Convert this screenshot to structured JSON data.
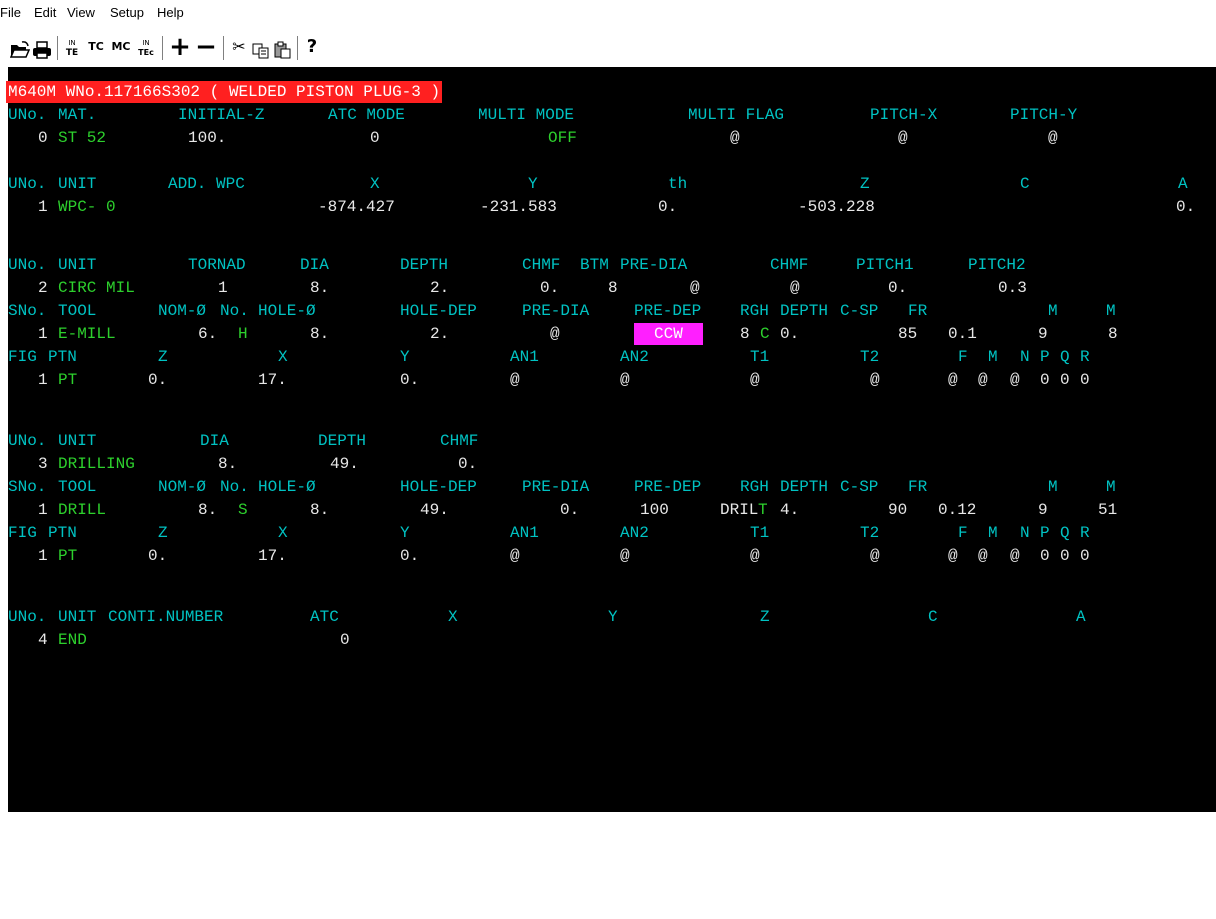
{
  "menu": [
    "File",
    "Edit",
    "View",
    "Setup",
    "Help"
  ],
  "toolbar": {
    "icons": [
      {
        "name": "open-icon",
        "glyph": "📂"
      },
      {
        "name": "print-icon",
        "glyph": "🖶"
      },
      {
        "name": "tool-te-icon",
        "glyph": "IN\nTE"
      },
      {
        "name": "tc-icon",
        "glyph": "TC"
      },
      {
        "name": "mc-icon",
        "glyph": "MC"
      },
      {
        "name": "tool-tec-icon",
        "glyph": "IN\nTEc"
      },
      {
        "name": "plus-icon",
        "glyph": "+"
      },
      {
        "name": "minus-icon",
        "glyph": "—"
      },
      {
        "name": "cut-icon",
        "glyph": "✂"
      },
      {
        "name": "copy-icon",
        "glyph": "⧉"
      },
      {
        "name": "paste-icon",
        "glyph": "📋"
      },
      {
        "name": "help-icon",
        "glyph": "❓"
      }
    ]
  },
  "program": {
    "title": "M640M WNo.117166S302 ( WELDED PISTON PLUG-3 )",
    "unit0": {
      "headers": [
        "UNo.",
        "MAT.",
        "INITIAL-Z",
        "ATC MODE",
        "MULTI MODE",
        "MULTI FLAG",
        "PITCH-X",
        "PITCH-Y"
      ],
      "values": [
        "0",
        "ST 52",
        "100.",
        "0",
        "OFF",
        "@",
        "@",
        "@"
      ]
    },
    "unit1": {
      "headers": [
        "UNo.",
        "UNIT",
        "ADD. WPC",
        "X",
        "Y",
        "th",
        "Z",
        "C",
        "A"
      ],
      "values": [
        "1",
        "WPC- 0",
        "-874.427",
        "-231.583",
        "0.",
        "-503.228",
        "0."
      ]
    },
    "unit2": {
      "headers": [
        "UNo.",
        "UNIT",
        "TORNAD",
        "DIA",
        "DEPTH",
        "CHMF",
        "BTM",
        "PRE-DIA",
        "CHMF",
        "PITCH1",
        "PITCH2"
      ],
      "values": [
        "2",
        "CIRC MIL",
        "1",
        "8.",
        "2.",
        "0.",
        "8",
        "@",
        "@",
        "0.",
        "0.3"
      ],
      "tool_headers": [
        "SNo.",
        "TOOL",
        "NOM-Ø",
        "No.",
        "HOLE-Ø",
        "HOLE-DEP",
        "PRE-DIA",
        "PRE-DEP",
        "RGH",
        "DEPTH",
        "C-SP",
        "FR",
        "M",
        "M"
      ],
      "tool_values": [
        "1",
        "E-MILL",
        "6.",
        "H",
        "8.",
        "2.",
        "@",
        "CCW",
        "8",
        "C",
        "0.",
        "85",
        "0.1",
        "9",
        "8"
      ],
      "fig_headers": [
        "FIG",
        "PTN",
        "Z",
        "X",
        "Y",
        "AN1",
        "AN2",
        "T1",
        "T2",
        "F",
        "M",
        "N",
        "P",
        "Q",
        "R"
      ],
      "fig_values": [
        "1",
        "PT",
        "0.",
        "17.",
        "0.",
        "@",
        "@",
        "@",
        "@",
        "@",
        "@",
        "@",
        "0",
        "0",
        "0"
      ]
    },
    "unit3": {
      "headers": [
        "UNo.",
        "UNIT",
        "DIA",
        "DEPTH",
        "CHMF"
      ],
      "values": [
        "3",
        "DRILLING",
        "8.",
        "49.",
        "0."
      ],
      "tool_headers": [
        "SNo.",
        "TOOL",
        "NOM-Ø",
        "No.",
        "HOLE-Ø",
        "HOLE-DEP",
        "PRE-DIA",
        "PRE-DEP",
        "RGH",
        "DEPTH",
        "C-SP",
        "FR",
        "M",
        "M"
      ],
      "tool_values": [
        "1",
        "DRILL",
        "8.",
        "S",
        "8.",
        "49.",
        "0.",
        "100",
        "DRIL",
        "T",
        "4.",
        "90",
        "0.12",
        "9",
        "51"
      ],
      "fig_headers": [
        "FIG",
        "PTN",
        "Z",
        "X",
        "Y",
        "AN1",
        "AN2",
        "T1",
        "T2",
        "F",
        "M",
        "N",
        "P",
        "Q",
        "R"
      ],
      "fig_values": [
        "1",
        "PT",
        "0.",
        "17.",
        "0.",
        "@",
        "@",
        "@",
        "@",
        "@",
        "@",
        "@",
        "0",
        "0",
        "0"
      ]
    },
    "unit4": {
      "headers": [
        "UNo.",
        "UNIT",
        "CONTI.NUMBER",
        "ATC",
        "X",
        "Y",
        "Z",
        "C",
        "A"
      ],
      "values": [
        "4",
        "END",
        "0"
      ]
    }
  },
  "colors": {
    "background": "#000000",
    "header_text": "#00c2c2",
    "unit_name_text": "#2dd02d",
    "value_text": "#e8e8e8",
    "title_bar": "#ff2020",
    "highlight": "#ff1fff"
  }
}
